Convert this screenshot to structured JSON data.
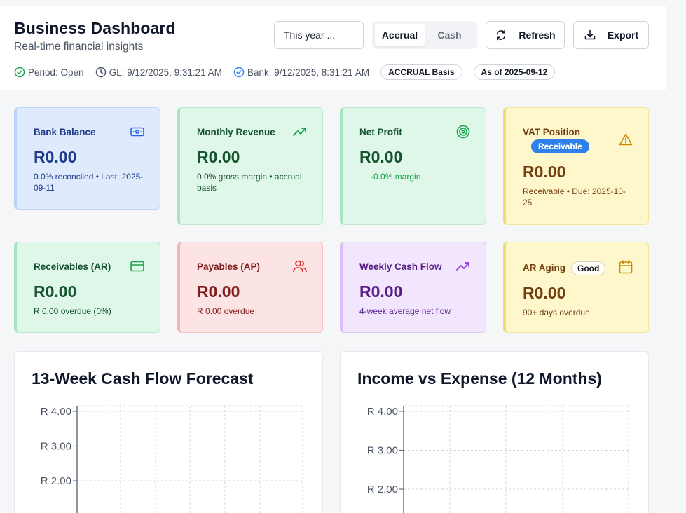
{
  "header": {
    "title": "Business Dashboard",
    "subtitle": "Real-time financial insights",
    "period_label": "Period: Open",
    "gl_label": "GL: 9/12/2025, 9:31:21 AM",
    "bank_label": "Bank: 9/12/2025, 8:31:21 AM",
    "basis_pill": "ACCRUAL Basis",
    "asof_pill": "As of 2025-09-12"
  },
  "controls": {
    "period_select": "This year ...",
    "basis_options": [
      "Accrual",
      "Cash"
    ],
    "basis_selected": "Accrual",
    "refresh_label": "Refresh",
    "export_label": "Export"
  },
  "cards": {
    "bank_balance": {
      "label": "Bank Balance",
      "value": "R0.00",
      "sub": "0.0% reconciled • Last: 2025-09-11",
      "icon": "banknote-icon"
    },
    "monthly_revenue": {
      "label": "Monthly Revenue",
      "value": "R0.00",
      "sub": "0.0% gross margin • accrual basis",
      "icon": "trending-up-icon"
    },
    "net_profit": {
      "label": "Net Profit",
      "value": "R0.00",
      "sub": "-0.0% margin",
      "icon": "target-icon"
    },
    "vat_position": {
      "label": "VAT Position",
      "badge": "Receivable",
      "value": "R0.00",
      "sub": "Receivable • Due: 2025-10-25",
      "icon": "alert-triangle-icon"
    },
    "receivables": {
      "label": "Receivables (AR)",
      "value": "R0.00",
      "sub": "R 0.00 overdue (0%)",
      "icon": "credit-card-icon"
    },
    "payables": {
      "label": "Payables (AP)",
      "value": "R0.00",
      "sub": "R 0.00 overdue",
      "icon": "users-icon"
    },
    "weekly_cash_flow": {
      "label": "Weekly Cash Flow",
      "value": "R0.00",
      "sub": "4-week average net flow",
      "icon": "trending-up-icon"
    },
    "ar_aging": {
      "label": "AR Aging",
      "badge": "Good",
      "value": "R0.00",
      "sub": "90+ days overdue",
      "icon": "calendar-icon"
    }
  },
  "colors": {
    "accent_blue": "#2f80ed",
    "success_green": "#16a34a",
    "danger_red": "#dc2626",
    "warning_amber": "#ca8a04",
    "purple": "#9333ea"
  },
  "chart_data": [
    {
      "type": "line",
      "title": "13-Week Cash Flow Forecast",
      "y_ticks": [
        "R 4.00",
        "R 3.00",
        "R 2.00"
      ],
      "y_tick_values": [
        4,
        3,
        2
      ],
      "grid": true,
      "series": []
    },
    {
      "type": "bar",
      "title": "Income vs Expense (12 Months)",
      "y_ticks": [
        "R 4.00",
        "R 3.00",
        "R 2.00"
      ],
      "y_tick_values": [
        4,
        3,
        2
      ],
      "grid": true,
      "series": []
    }
  ]
}
